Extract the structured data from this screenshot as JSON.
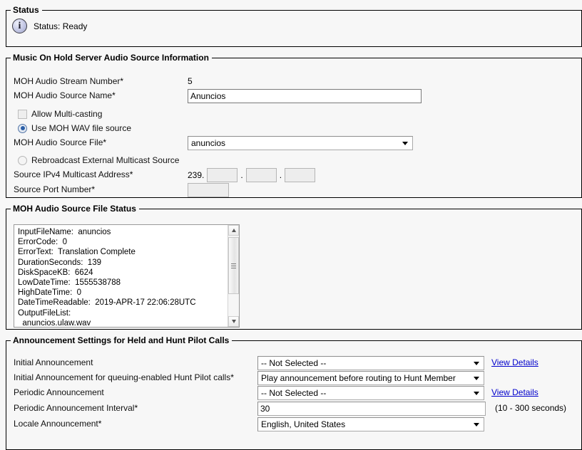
{
  "status_group": {
    "legend": "Status",
    "icon": "info-icon",
    "icon_glyph": "i",
    "text": "Status: Ready"
  },
  "moh_group": {
    "legend": "Music On Hold Server Audio Source Information",
    "stream_number": {
      "label": "MOH Audio Stream Number",
      "required": "*",
      "value": "5"
    },
    "source_name": {
      "label": "MOH Audio Source Name",
      "required": "*",
      "value": "Anuncios"
    },
    "allow_multicast": {
      "label": "Allow Multi-casting",
      "checked": false
    },
    "use_wav": {
      "label": "Use MOH WAV file source",
      "selected": true
    },
    "source_file": {
      "label": "MOH Audio Source File",
      "required": "*",
      "value": "anuncios"
    },
    "rebroadcast": {
      "label": "Rebroadcast External Multicast Source",
      "selected": false
    },
    "multicast_address": {
      "label": "Source IPv4 Multicast Address",
      "required": "*",
      "prefix": "239.",
      "dot": ".",
      "octet2": "",
      "octet3": "",
      "octet4": ""
    },
    "port_number": {
      "label": "Source Port Number",
      "required": "*",
      "value": ""
    }
  },
  "file_status_group": {
    "legend": "MOH Audio Source File Status",
    "content": "InputFileName:  anuncios\nErrorCode:  0\nErrorText:  Translation Complete\nDurationSeconds:  139\nDiskSpaceKB:  6624\nLowDateTime:  1555538788\nHighDateTime:  0\nDateTimeReadable:  2019-APR-17 22:06:28UTC\nOutputFileList:\n  anuncios.ulaw.wav\n  anuncios.alaw.wav"
  },
  "announcement_group": {
    "legend": "Announcement Settings for Held and Hunt Pilot Calls",
    "view_details_label": "View Details",
    "initial": {
      "label": "Initial Announcement",
      "required": "",
      "value": "-- Not Selected --"
    },
    "initial_queuing": {
      "label": "Initial Announcement for queuing-enabled Hunt Pilot calls",
      "required": "*",
      "value": "Play announcement before routing to Hunt Member"
    },
    "periodic": {
      "label": "Periodic Announcement",
      "required": "",
      "value": "-- Not Selected --"
    },
    "periodic_interval": {
      "label": "Periodic Announcement Interval",
      "required": "*",
      "value": "30",
      "hint": "(10 - 300 seconds)"
    },
    "locale": {
      "label": "Locale Announcement",
      "required": "*",
      "value": "English, United States"
    }
  },
  "colors": {
    "page_bg": "#f7f7f7",
    "border": "#000000",
    "link": "#0000cc",
    "radio_accent": "#2b5fa8"
  }
}
